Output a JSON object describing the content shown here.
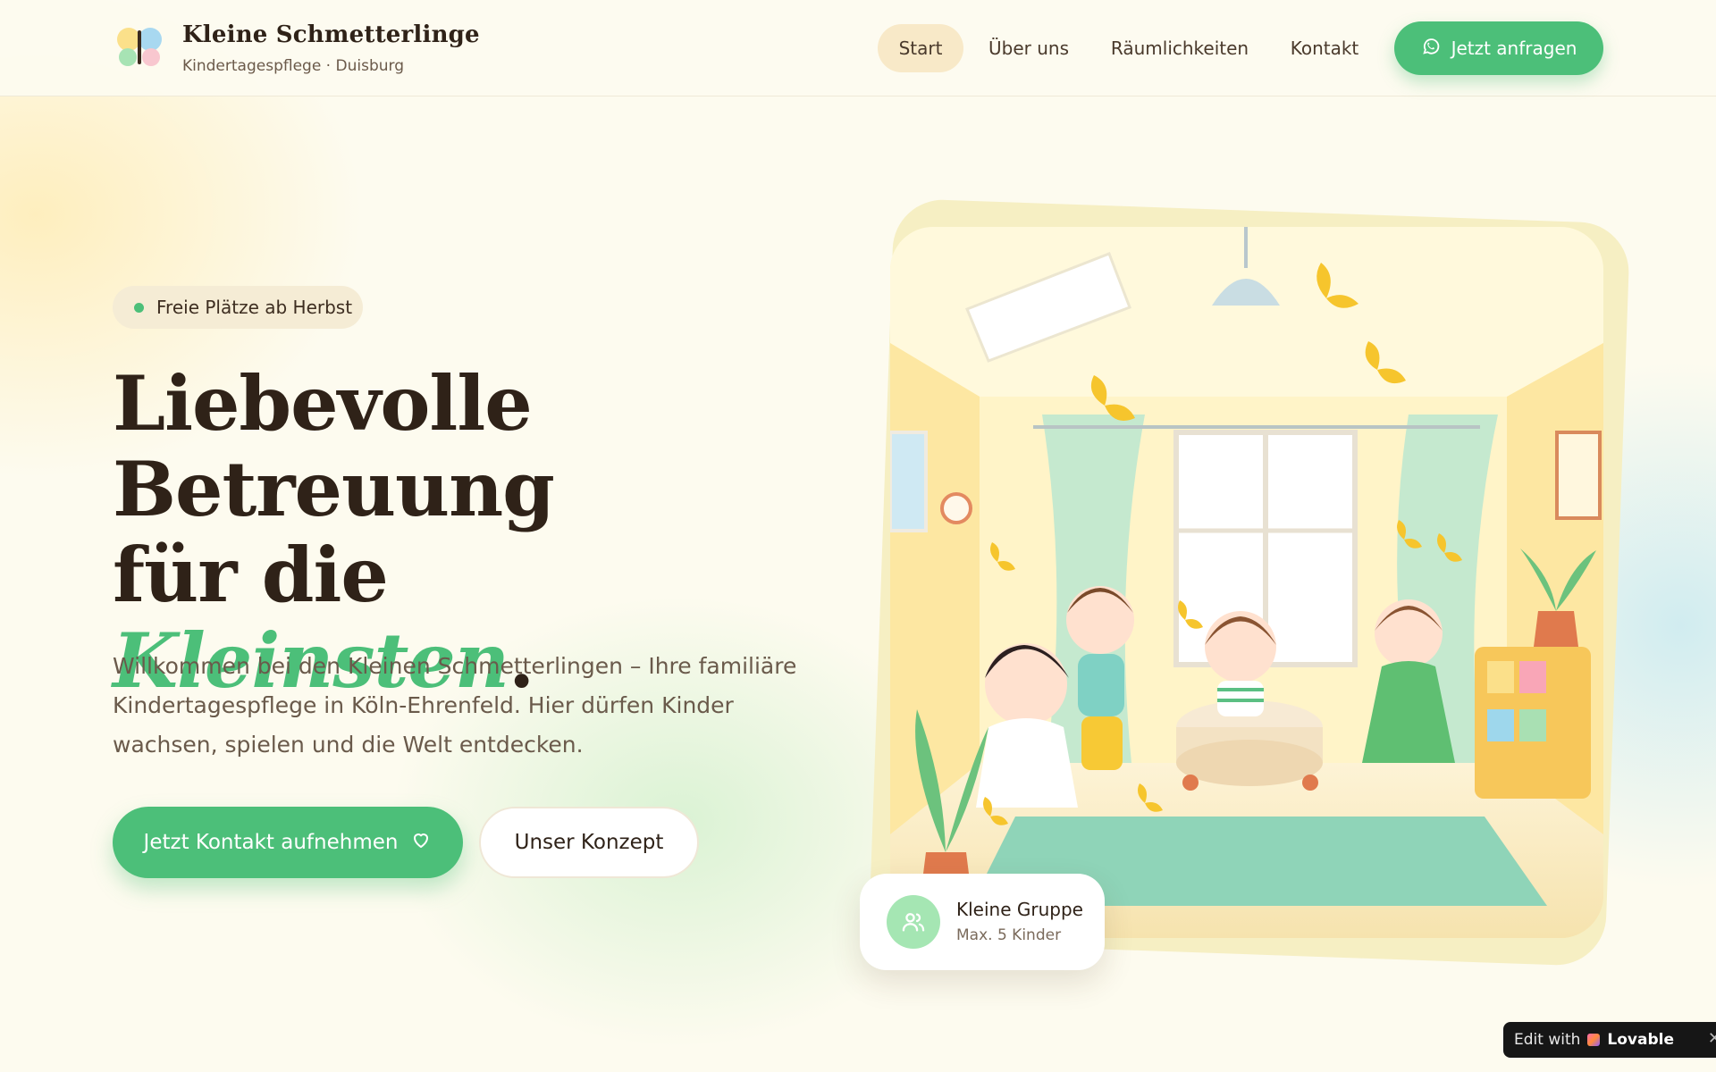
{
  "brand": {
    "title": "Kleine Schmetterlinge",
    "subtitle": "Kindertagespflege · Duisburg",
    "logo_icon": "butterfly-logo-icon"
  },
  "nav": {
    "items": [
      {
        "label": "Start",
        "active": true
      },
      {
        "label": "Über uns",
        "active": false
      },
      {
        "label": "Räumlichkeiten",
        "active": false
      },
      {
        "label": "Kontakt",
        "active": false
      }
    ],
    "cta_label": "Jetzt anfragen",
    "cta_icon": "whatsapp-icon"
  },
  "hero": {
    "badge": "Freie Plätze ab Herbst",
    "headline_line1": "Liebevolle",
    "headline_line2": "Betreuung",
    "headline_line3_prefix": "für die ",
    "headline_accent": "Kleinsten",
    "headline_end": ".",
    "intro": "Willkommen bei den Kleinen Schmetterlingen – Ihre familiäre Kindertagespflege in Köln-Ehrenfeld. Hier dürfen Kinder wachsen, spielen und die Welt entdecken.",
    "primary_button": "Jetzt Kontakt aufnehmen",
    "primary_icon": "heart-icon",
    "secondary_button": "Unser Konzept"
  },
  "feature_card": {
    "title": "Kleine Gruppe",
    "subtitle": "Max. 5 Kinder",
    "icon": "users-icon"
  },
  "lovable_badge": {
    "prefix": "Edit with",
    "brand": "Lovable",
    "close": "✕"
  },
  "colors": {
    "accent_green": "#4cbf79",
    "background_cream": "#fdfbef",
    "text_dark": "#2f2218",
    "badge_bg": "#f5ecd5"
  }
}
